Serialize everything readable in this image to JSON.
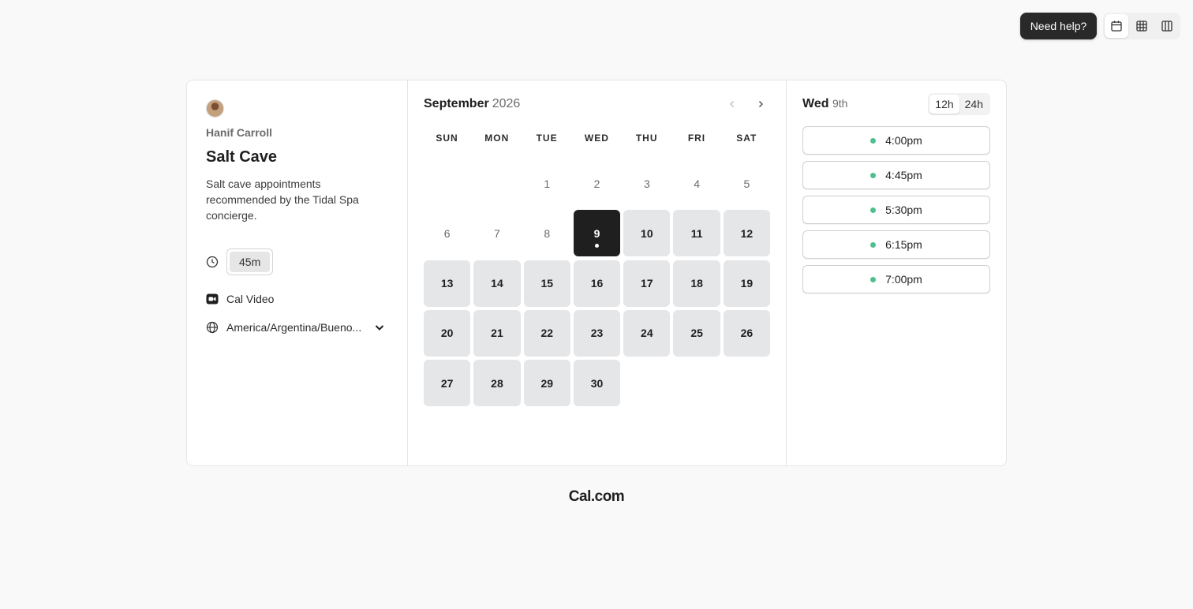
{
  "help": {
    "label": "Need help?"
  },
  "view_toggle": {
    "items": [
      {
        "icon": "calendar-icon",
        "active": true
      },
      {
        "icon": "grid-icon",
        "active": false
      },
      {
        "icon": "columns-icon",
        "active": false
      }
    ]
  },
  "event": {
    "host": "Hanif Carroll",
    "title": "Salt Cave",
    "description": "Salt cave appointments recommended by the Tidal Spa concierge.",
    "duration": "45m",
    "location": "Cal Video",
    "timezone": "America/Argentina/Bueno..."
  },
  "calendar": {
    "month": "September",
    "year": "2026",
    "weekdays": [
      "SUN",
      "MON",
      "TUE",
      "WED",
      "THU",
      "FRI",
      "SAT"
    ],
    "leading_blanks": 2,
    "days": [
      {
        "n": "1",
        "state": "off"
      },
      {
        "n": "2",
        "state": "off"
      },
      {
        "n": "3",
        "state": "off"
      },
      {
        "n": "4",
        "state": "off"
      },
      {
        "n": "5",
        "state": "off"
      },
      {
        "n": "6",
        "state": "off"
      },
      {
        "n": "7",
        "state": "off"
      },
      {
        "n": "8",
        "state": "off"
      },
      {
        "n": "9",
        "state": "sel"
      },
      {
        "n": "10",
        "state": "avail"
      },
      {
        "n": "11",
        "state": "avail"
      },
      {
        "n": "12",
        "state": "avail"
      },
      {
        "n": "13",
        "state": "avail"
      },
      {
        "n": "14",
        "state": "avail"
      },
      {
        "n": "15",
        "state": "avail"
      },
      {
        "n": "16",
        "state": "avail"
      },
      {
        "n": "17",
        "state": "avail"
      },
      {
        "n": "18",
        "state": "avail"
      },
      {
        "n": "19",
        "state": "avail"
      },
      {
        "n": "20",
        "state": "avail"
      },
      {
        "n": "21",
        "state": "avail"
      },
      {
        "n": "22",
        "state": "avail"
      },
      {
        "n": "23",
        "state": "avail"
      },
      {
        "n": "24",
        "state": "avail"
      },
      {
        "n": "25",
        "state": "avail"
      },
      {
        "n": "26",
        "state": "avail"
      },
      {
        "n": "27",
        "state": "avail"
      },
      {
        "n": "28",
        "state": "avail"
      },
      {
        "n": "29",
        "state": "avail"
      },
      {
        "n": "30",
        "state": "avail"
      }
    ]
  },
  "times": {
    "weekday": "Wed",
    "date": "9th",
    "formats": [
      "12h",
      "24h"
    ],
    "active_format": "12h",
    "slots": [
      "4:00pm",
      "4:45pm",
      "5:30pm",
      "6:15pm",
      "7:00pm"
    ]
  },
  "brand": "Cal.com"
}
